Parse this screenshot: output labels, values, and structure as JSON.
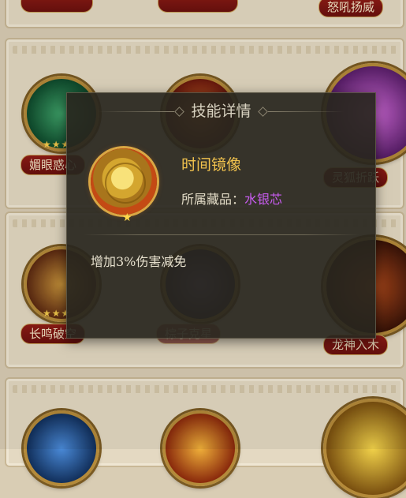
{
  "popup": {
    "title": "技能详情",
    "skill_name": "时间镜像",
    "collection_label": "所属藏品：",
    "collection_value": "水银芯",
    "description": "增加3%伤害减免",
    "skill_star": "★",
    "colors": {
      "skill_name": "#f1c24d",
      "collection_value": "#c85cf0",
      "panel_bg": "#28261e"
    }
  },
  "background": {
    "tags": {
      "top_right": "怒吼扬威",
      "row1_left": "媚眼惑心",
      "row1_right": "灵狐折跃",
      "row2_left": "长鸣破空",
      "row2_mid": "棕子克星",
      "row2_right": "龙神入木"
    },
    "stars": {
      "row1_left": "★★★",
      "row2_left": "★★★"
    }
  }
}
